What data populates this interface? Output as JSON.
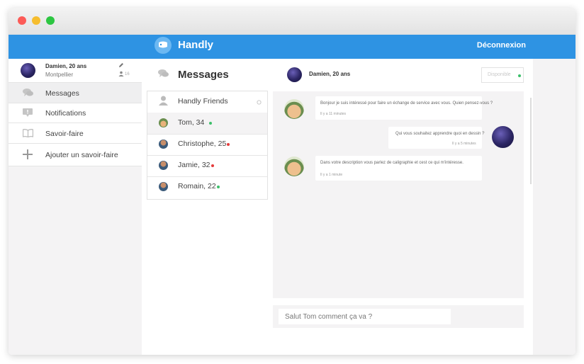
{
  "app": {
    "brand": "Handly",
    "logout_label": "Déconnexion",
    "accent_color": "#2e93e3"
  },
  "profile": {
    "name": "Damien, 20 ans",
    "city": "Montpellier",
    "count": "16"
  },
  "sidebar": {
    "items": [
      {
        "label": "Messages",
        "icon": "chat-bubbles-icon"
      },
      {
        "label": "Notifications",
        "icon": "notification-icon"
      },
      {
        "label": "Savoir-faire",
        "icon": "book-icon"
      },
      {
        "label": "Ajouter un savoir-faire",
        "icon": "plus-icon"
      }
    ]
  },
  "messages": {
    "title": "Messages",
    "group_label": "Handly Friends",
    "contacts": [
      {
        "label": "Tom, 34",
        "status_color": "#3cbf6a"
      },
      {
        "label": "Christophe, 25",
        "status_color": "#e53b3b"
      },
      {
        "label": "Jamie, 32",
        "status_color": "#e53b3b"
      },
      {
        "label": "Romain, 22",
        "status_color": "#3cbf6a"
      }
    ]
  },
  "chat": {
    "header_name": "Damien, 20 ans",
    "status_label": "Disponible",
    "messages": [
      {
        "text": "Bonjour je suis intéressé pour faire un échange de service avec vous. Quien pensez-vous ?",
        "time": "Il y a 11 minutes"
      },
      {
        "text": "Qui vous souhaitez apprendre quoi en dessin ?",
        "time": "Il y a 5 minutes"
      },
      {
        "text": "Dans votre description vous parlez de caligraphie et cest ce qui m'intéresse.",
        "time": "Il y a 1 minute"
      }
    ],
    "input_placeholder": "Salut Tom comment ça va ?"
  }
}
